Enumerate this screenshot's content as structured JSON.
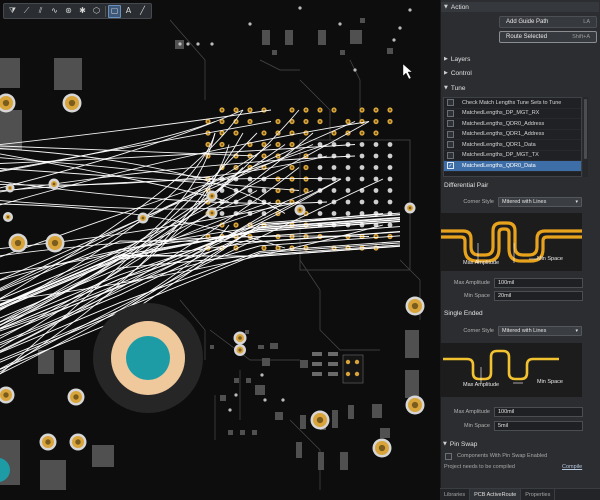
{
  "toolbar": {
    "buttons": [
      {
        "name": "filter-tool",
        "glyph": "⧩"
      },
      {
        "name": "route-tool",
        "glyph": "⟋"
      },
      {
        "name": "diff-pair-tool",
        "glyph": "⫽"
      },
      {
        "name": "multi-route-tool",
        "glyph": "∿"
      },
      {
        "name": "via-tool",
        "glyph": "⊛"
      },
      {
        "name": "pad-tool",
        "glyph": "✱"
      },
      {
        "name": "polygon-tool",
        "glyph": "⬡"
      },
      {
        "name": "select-tool",
        "glyph": "▢"
      },
      {
        "name": "text-tool",
        "glyph": "A"
      },
      {
        "name": "line-tool",
        "glyph": "╱"
      }
    ],
    "active_index": 7
  },
  "panel": {
    "action_header": "Action",
    "add_guide_path": {
      "label": "Add Guide Path",
      "shortcut": "LA"
    },
    "route_selected": {
      "label": "Route Selected",
      "shortcut": "Shift+A"
    },
    "layers_header": "Layers",
    "control_header": "Control",
    "tune_header": "Tune",
    "tune_items": [
      {
        "label": "Check Match Lengths Tune Sets to Tune",
        "checked": false
      },
      {
        "label": "MatchedLengths_DP_MGT_RX",
        "checked": false
      },
      {
        "label": "MatchedLengths_QDR0_Address",
        "checked": false
      },
      {
        "label": "MatchedLengths_QDR1_Address",
        "checked": false
      },
      {
        "label": "MatchedLengths_QDR1_Data",
        "checked": false
      },
      {
        "label": "MatchedLengths_DP_MGT_TX",
        "checked": false
      },
      {
        "label": "MatchedLengths_QDR0_Data",
        "checked": true,
        "selected": true
      }
    ],
    "diff_pair": {
      "header": "Differential Pair",
      "corner_style_label": "Corner Style",
      "corner_style_value": "Mitered with Lines",
      "diagram_max_amplitude": "Max Amplitude",
      "diagram_min_space": "Min Space",
      "max_amplitude_label": "Max Amplitude",
      "max_amplitude_value": "100mil",
      "min_space_label": "Min Space",
      "min_space_value": "20mil"
    },
    "single_ended": {
      "header": "Single Ended",
      "corner_style_label": "Corner Style",
      "corner_style_value": "Mitered with Lines",
      "diagram_max_amplitude": "Max Amplitude",
      "diagram_min_space": "Min Space",
      "max_amplitude_label": "Max Amplitude",
      "max_amplitude_value": "100mil",
      "min_space_label": "Min Space",
      "min_space_value": "5mil"
    },
    "pin_swap_header": "Pin Swap",
    "pin_swap_option": "Components With Pin Swap Enabled",
    "compile_message": "Project needs to be compiled",
    "compile_link": "Compile",
    "tabs": [
      "Libraries",
      "PCB ActiveRoute",
      "Properties"
    ],
    "active_tab": 1
  },
  "colors": {
    "board": "#0d0d0d",
    "panel": "#2b2d30",
    "trace": "#ffffff",
    "pad_gold": "#d9a43a",
    "pad_core": "#7a5c1e",
    "copper_gray": "#505050",
    "selection_blue": "#3d6ea7",
    "tune_trace": "#f2c230",
    "via_teal": "#1d9ca6",
    "via_ring": "#efc89c"
  }
}
